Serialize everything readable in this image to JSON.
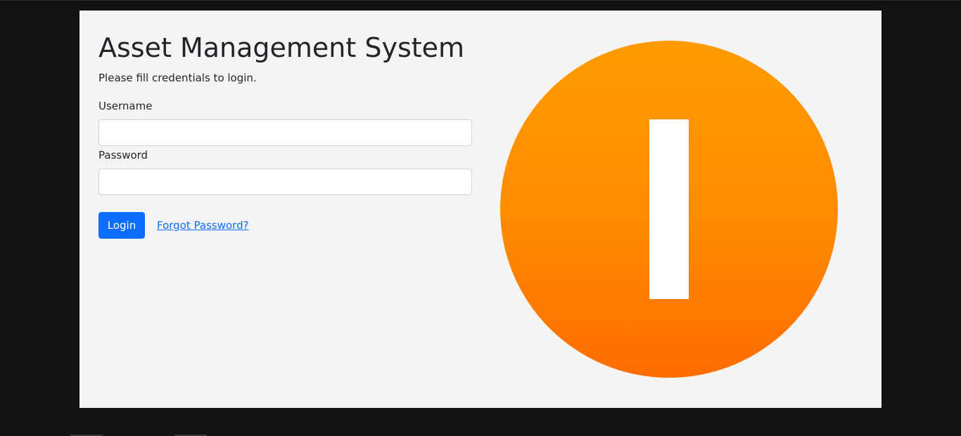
{
  "app": {
    "title": "Asset Management System",
    "subtitle": "Please fill credentials to login."
  },
  "form": {
    "username": {
      "label": "Username",
      "value": "",
      "placeholder": ""
    },
    "password": {
      "label": "Password",
      "value": "",
      "placeholder": ""
    },
    "login_label": "Login",
    "forgot_label": "Forgot Password?"
  },
  "logo": {
    "icon": "logo-i-icon",
    "gradient_top": "#ff9b00",
    "gradient_bottom": "#ff6c00",
    "bar_color": "#ffffff"
  },
  "colors": {
    "accent": "#0d6efd",
    "page_background": "#121212",
    "card_background": "#f4f4f4",
    "text": "#212529"
  }
}
